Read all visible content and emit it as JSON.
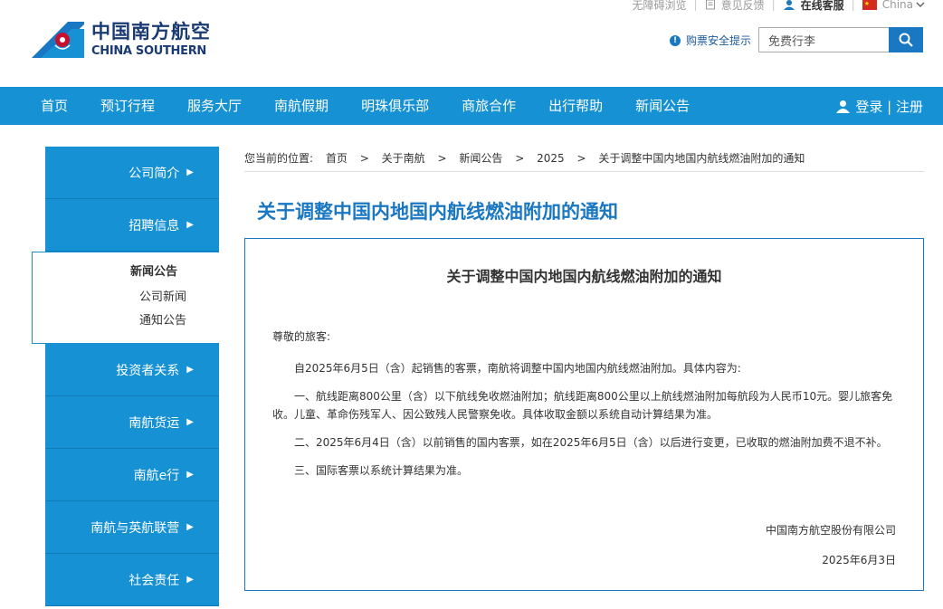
{
  "top_links": {
    "accessibility": "无障碍浏览",
    "feedback": "意见反馈",
    "online_service": "在线客服",
    "region": "China"
  },
  "logo": {
    "cn": "中国南方航空",
    "en": "CHINA SOUTHERN"
  },
  "safety_tip": "购票安全提示",
  "search": {
    "value": "免费行李"
  },
  "nav": {
    "items": [
      "首页",
      "预订行程",
      "服务大厅",
      "南航假期",
      "明珠俱乐部",
      "商旅合作",
      "出行帮助",
      "新闻公告"
    ],
    "login": "登录 | 注册"
  },
  "sidebar": {
    "items_top": [
      "公司简介",
      "招聘信息"
    ],
    "active": {
      "title": "新闻公告",
      "subs": [
        "公司新闻",
        "通知公告"
      ]
    },
    "items_bottom": [
      "投资者关系",
      "南航货运",
      "南航e行",
      "南航与英航联营",
      "社会责任"
    ]
  },
  "breadcrumb": {
    "prefix": "您当前的位置:",
    "items": [
      "首页",
      "关于南航",
      "新闻公告",
      "2025",
      "关于调整中国内地国内航线燃油附加的通知"
    ]
  },
  "page_title": "关于调整中国内地国内航线燃油附加的通知",
  "article": {
    "title": "关于调整中国内地国内航线燃油附加的通知",
    "greeting": "尊敬的旅客:",
    "paragraphs": [
      "自2025年6月5日（含）起销售的客票，南航将调整中国内地国内航线燃油附加。具体内容为:",
      "一、航线距离800公里（含）以下航线免收燃油附加；航线距离800公里以上航线燃油附加每航段为人民币10元。婴儿旅客免收。儿童、革命伤残军人、因公致残人民警察免收。具体收取金额以系统自动计算结果为准。",
      "二、2025年6月4日（含）以前销售的国内客票，如在2025年6月5日（含）以后进行变更，已收取的燃油附加费不退不补。",
      "三、国际客票以系统计算结果为准。"
    ],
    "signature": "中国南方航空股份有限公司",
    "date": "2025年6月3日"
  },
  "colors": {
    "brand_blue": "#1591d4",
    "title_blue": "#1a77c2",
    "logo_navy": "#1a3a73"
  }
}
